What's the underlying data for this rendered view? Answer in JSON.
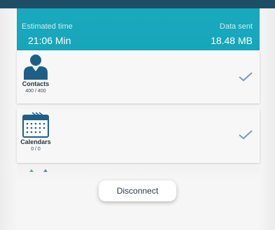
{
  "header": {
    "estimated_time_label": "Estimated time",
    "estimated_time_value": "21:06 Min",
    "data_sent_label": "Data sent",
    "data_sent_value": "18.48 MB"
  },
  "items": [
    {
      "label": "Contacts",
      "count": "400 / 400",
      "icon": "person-icon",
      "status": "checked"
    },
    {
      "label": "Calendars",
      "count": "0 / 0",
      "icon": "calendar-icon",
      "status": "checked"
    }
  ],
  "actions": {
    "disconnect_label": "Disconnect"
  },
  "colors": {
    "top_bar": "#1d4e66",
    "header_accent": "#1aa8bd",
    "icon_blue": "#1e5f86",
    "check_color": "#7b9bbb"
  }
}
